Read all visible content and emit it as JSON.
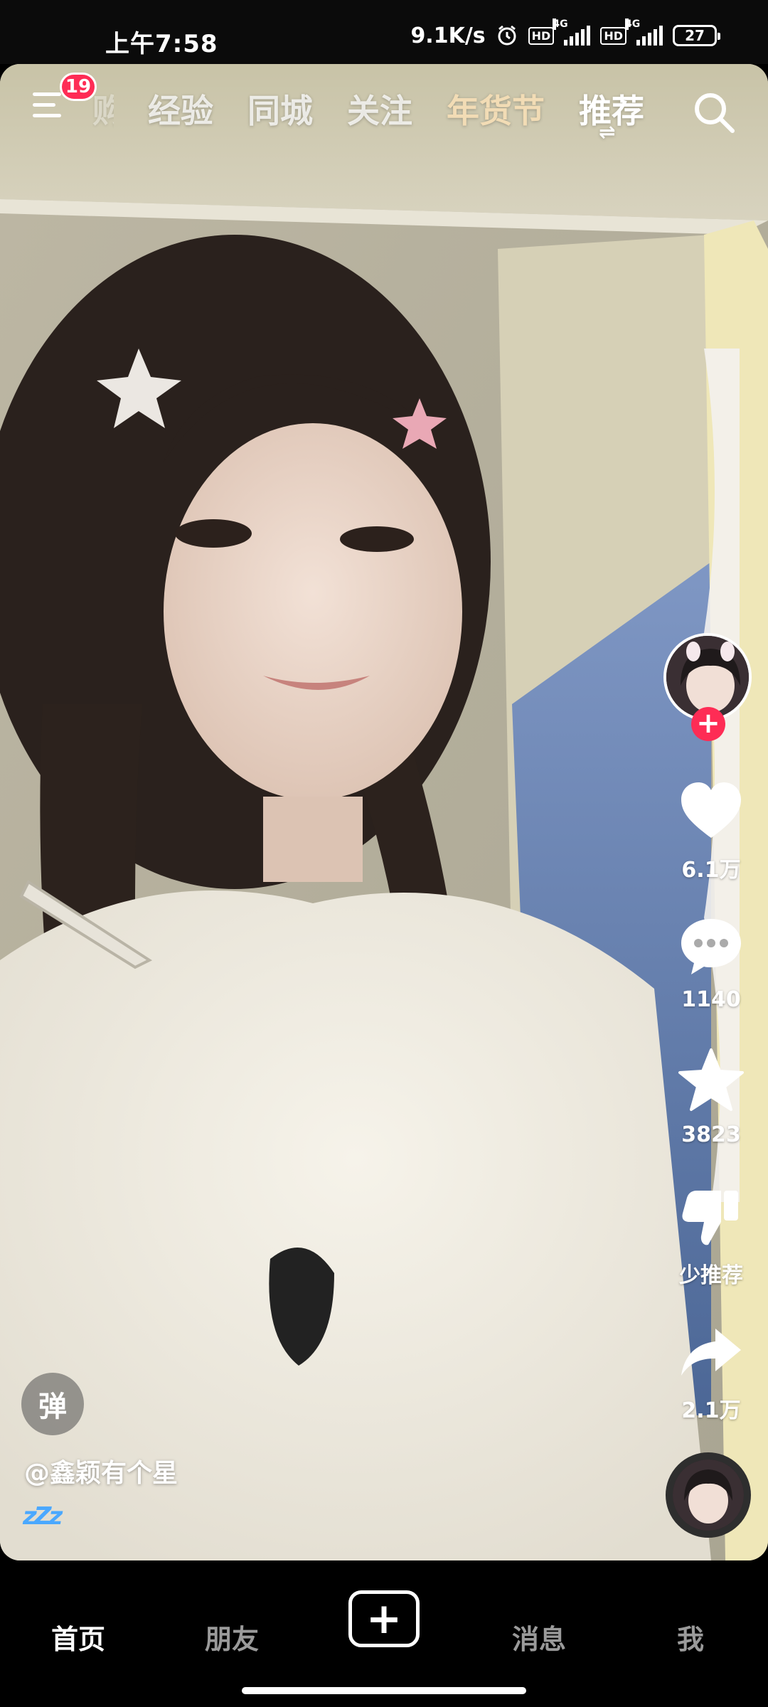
{
  "status_bar": {
    "time": "上午7:58",
    "net_speed": "9.1K/s",
    "alarm_icon": "alarm-clock-icon",
    "sim1_label": "HD",
    "sim1_tech": "4G",
    "sim2_label": "HD",
    "sim2_tech": "4G",
    "battery": "27"
  },
  "top_nav": {
    "menu_badge": "19",
    "tabs": [
      {
        "label": "购"
      },
      {
        "label": "经验"
      },
      {
        "label": "同城"
      },
      {
        "label": "关注"
      },
      {
        "label": "年货节"
      },
      {
        "label": "推荐"
      }
    ],
    "active_tab": "推荐",
    "swap_glyph": "⇌"
  },
  "actions": {
    "likes": "6.1万",
    "comments": "1140",
    "favorites": "3823",
    "dislike_label": "少推荐",
    "shares": "2.1万"
  },
  "video": {
    "danmaku_label": "弹",
    "author": "@鑫颖有个星",
    "caption_emoji": "zZz"
  },
  "bottom_nav": {
    "items": [
      {
        "label": "首页"
      },
      {
        "label": "朋友"
      },
      {
        "label": "消息"
      },
      {
        "label": "我"
      }
    ],
    "create_glyph": "+"
  },
  "colors": {
    "accent": "#fe2c55",
    "festival_tab": "#f2dcb5"
  }
}
